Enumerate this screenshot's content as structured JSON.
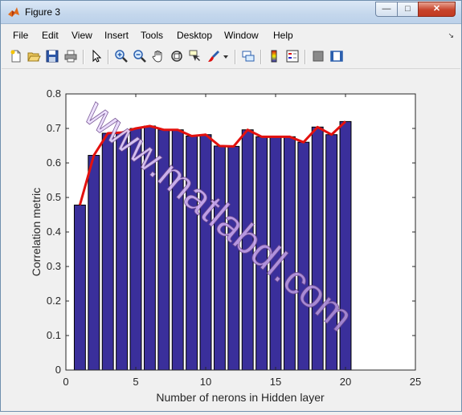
{
  "window": {
    "title": "Figure 3"
  },
  "window_buttons": {
    "minimize": "—",
    "maximize": "□",
    "close": "✕"
  },
  "menu": {
    "items": [
      "File",
      "Edit",
      "View",
      "Insert",
      "Tools",
      "Desktop",
      "Window",
      "Help"
    ],
    "dock_arrow": "↘"
  },
  "toolbar": {
    "icons": [
      "new-figure-icon",
      "open-file-icon",
      "save-icon",
      "print-icon",
      "pointer-icon",
      "zoom-in-icon",
      "zoom-out-icon",
      "pan-icon",
      "rotate-3d-icon",
      "data-cursor-icon",
      "brush-icon",
      "brush-dropdown-icon",
      "link-plot-icon",
      "colorbar-icon",
      "legend-icon",
      "hide-plot-tools-icon",
      "show-plot-tools-icon"
    ]
  },
  "watermark": "www.matlabdl.com",
  "colors": {
    "bar": "#3a2f9b",
    "line": "#e3110e",
    "watermark": "#c9a0e6"
  },
  "chart_data": {
    "type": "bar",
    "xlabel": "Number of nerons in Hidden layer",
    "ylabel": "Correlation metric",
    "xlim": [
      0,
      25
    ],
    "ylim": [
      0,
      0.8
    ],
    "xticks": [
      0,
      5,
      10,
      15,
      20,
      25
    ],
    "yticks": [
      0,
      0.1,
      0.2,
      0.3,
      0.4,
      0.5,
      0.6,
      0.7,
      0.8
    ],
    "x": [
      1,
      2,
      3,
      4,
      5,
      6,
      7,
      8,
      9,
      10,
      11,
      12,
      13,
      14,
      15,
      16,
      17,
      18,
      19,
      20
    ],
    "values": [
      0.478,
      0.622,
      0.686,
      0.688,
      0.7,
      0.707,
      0.696,
      0.696,
      0.678,
      0.682,
      0.649,
      0.648,
      0.696,
      0.676,
      0.676,
      0.676,
      0.66,
      0.704,
      0.682,
      0.72
    ],
    "line": [
      0.478,
      0.622,
      0.686,
      0.688,
      0.7,
      0.707,
      0.696,
      0.696,
      0.678,
      0.682,
      0.649,
      0.648,
      0.696,
      0.676,
      0.676,
      0.676,
      0.66,
      0.704,
      0.682,
      0.72
    ],
    "grid": false,
    "legend": "none"
  }
}
